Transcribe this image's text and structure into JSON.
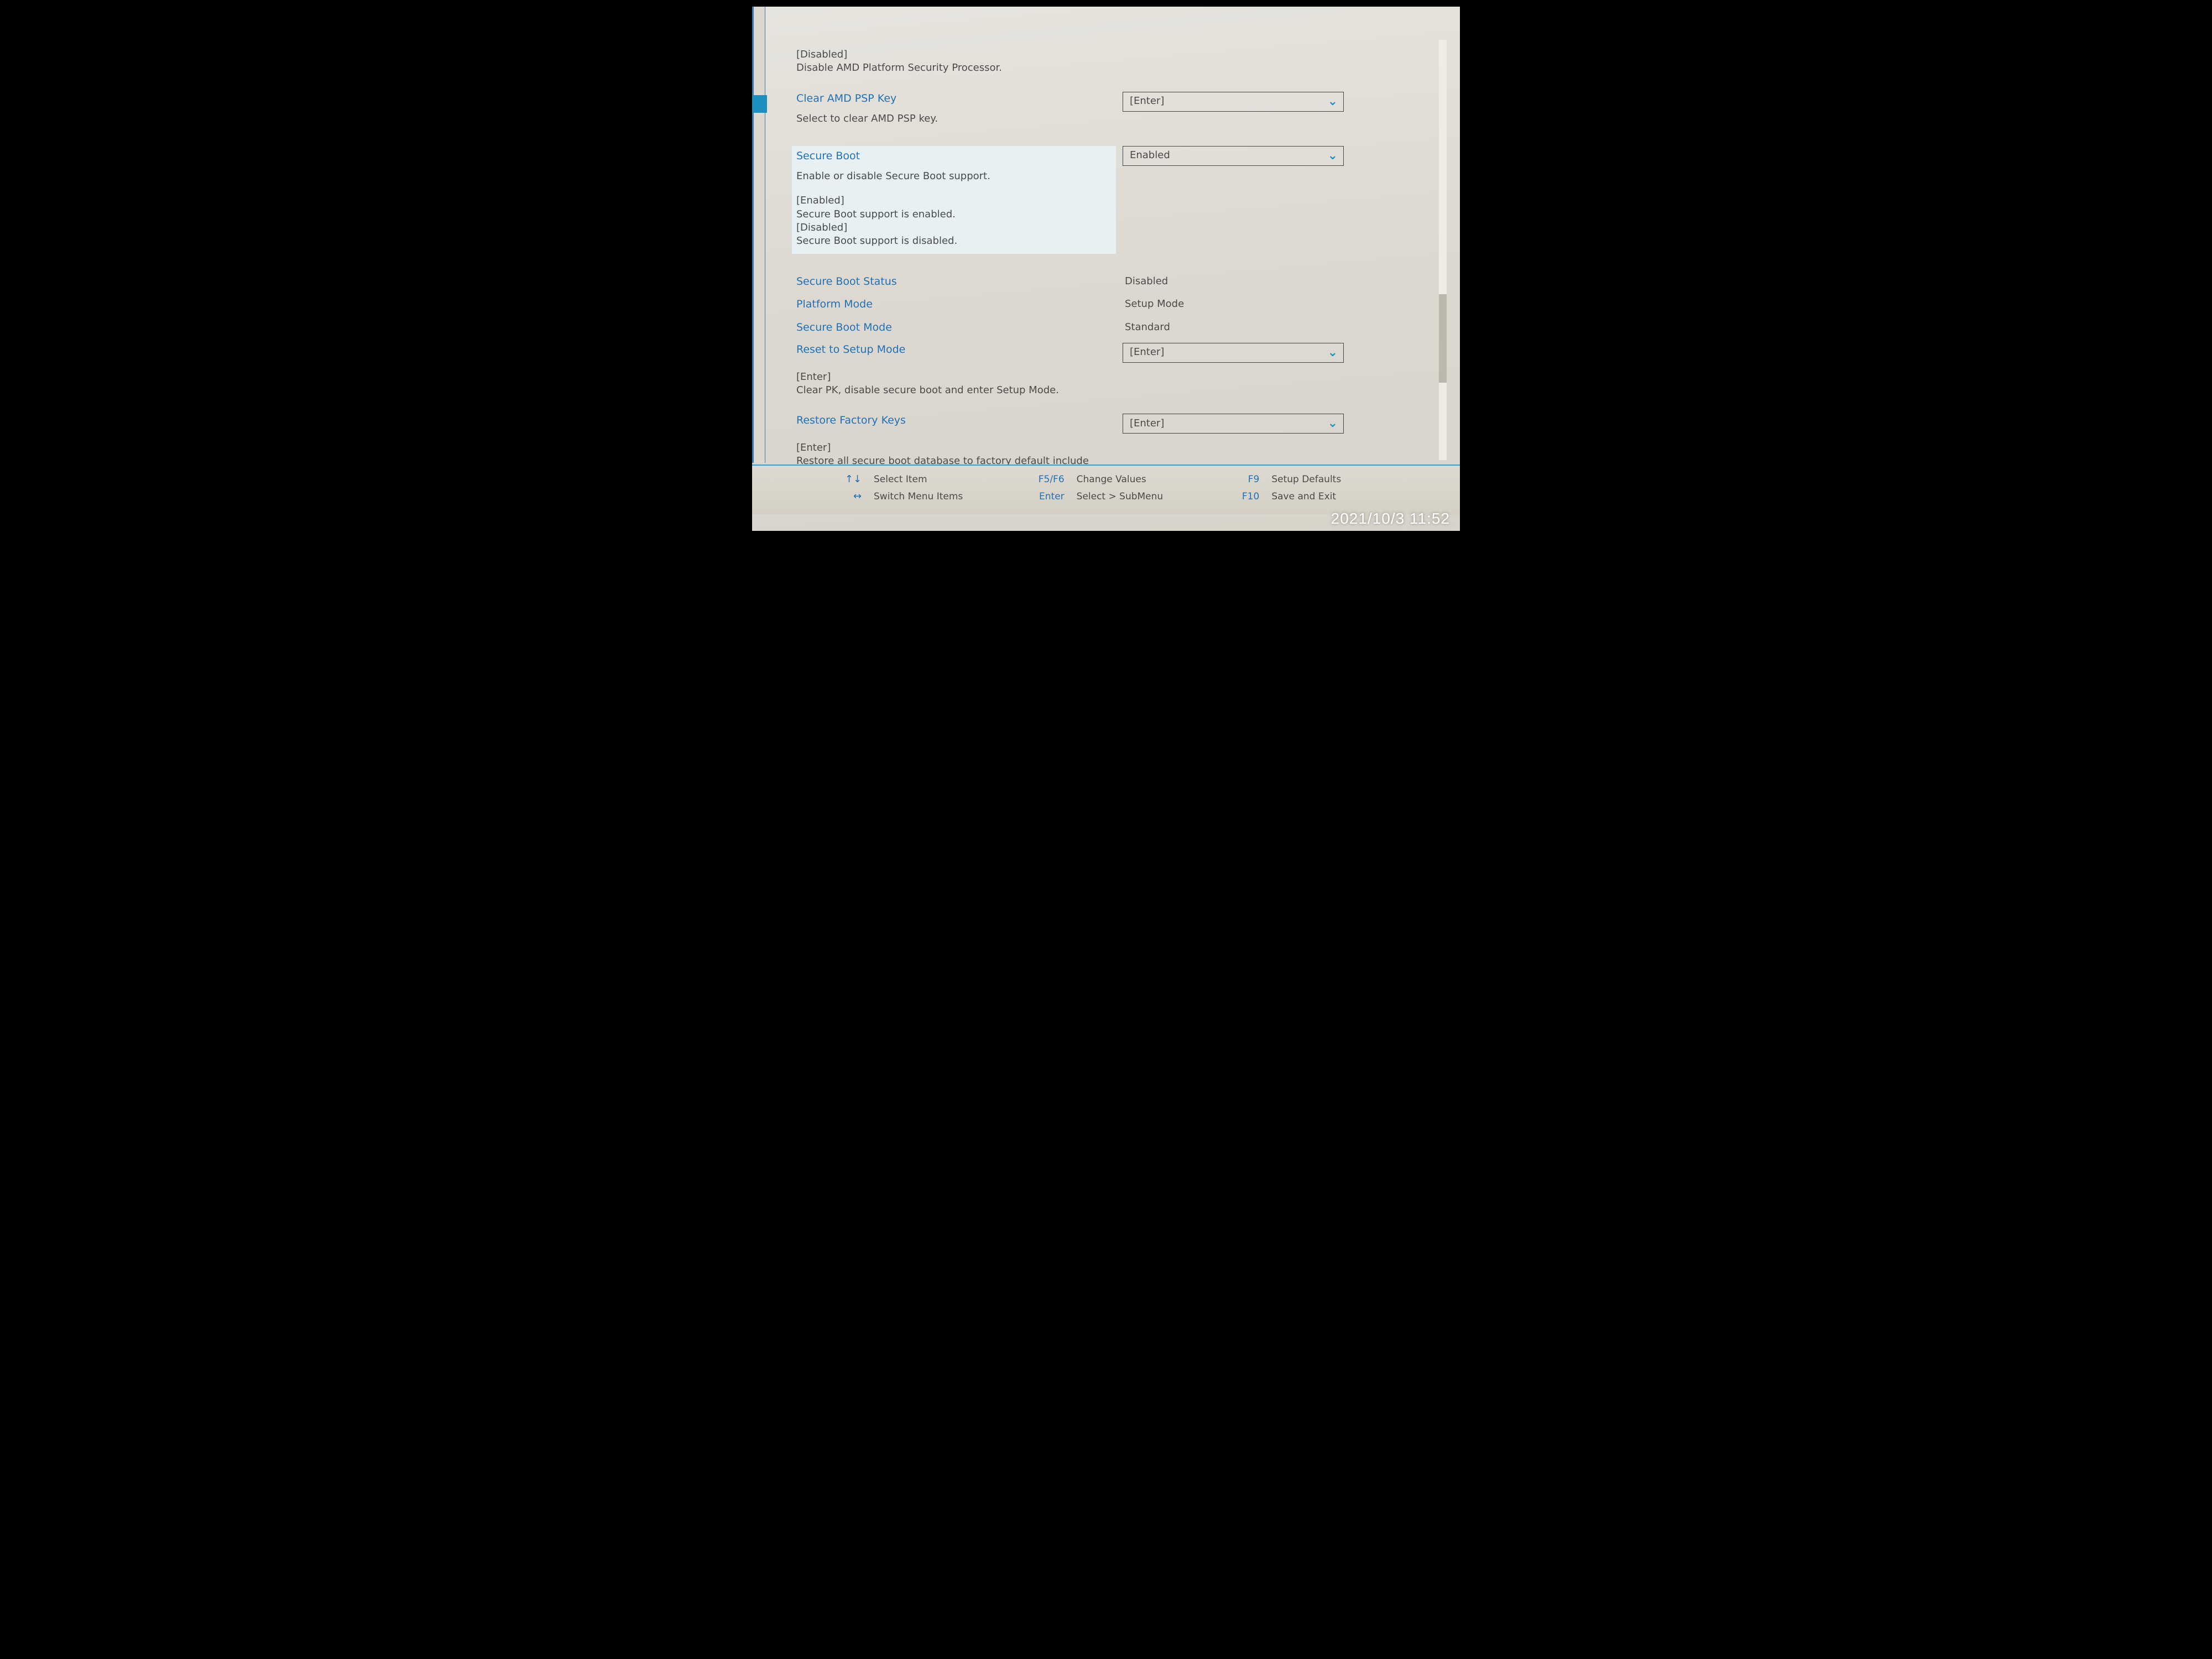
{
  "top_note": {
    "value_label": "[Disabled]",
    "desc": "Disable AMD Platform Security Processor."
  },
  "clear_psp": {
    "title": "Clear AMD PSP Key",
    "desc": "Select to clear AMD PSP key.",
    "value": "[Enter]"
  },
  "secure_boot": {
    "title": "Secure Boot",
    "desc": "Enable or disable Secure Boot support.",
    "opt_enabled_label": "[Enabled]",
    "opt_enabled_desc": "Secure Boot support is enabled.",
    "opt_disabled_label": "[Disabled]",
    "opt_disabled_desc": "Secure Boot support is disabled.",
    "value": "Enabled"
  },
  "status": {
    "label": "Secure Boot Status",
    "value": "Disabled"
  },
  "platform_mode": {
    "label": "Platform Mode",
    "value": "Setup Mode"
  },
  "sb_mode": {
    "label": "Secure Boot Mode",
    "value": "Standard"
  },
  "reset_setup": {
    "title": "Reset to Setup Mode",
    "value": "[Enter]",
    "note_label": "[Enter]",
    "note_desc": "Clear PK, disable secure boot and enter Setup Mode."
  },
  "restore_keys": {
    "title": "Restore Factory Keys",
    "value": "[Enter]",
    "note_label": "[Enter]",
    "note_desc": "Restore all secure boot database to factory default include PK, KEK, db and dbx."
  },
  "footer": {
    "select_item_key": "↑↓",
    "select_item": "Select Item",
    "switch_menu_key": "↔",
    "switch_menu": "Switch Menu Items",
    "change_values_key": "F5/F6",
    "change_values": "Change Values",
    "select_submenu_key": "Enter",
    "select_submenu": "Select > SubMenu",
    "defaults_key": "F9",
    "defaults": "Setup Defaults",
    "save_exit_key": "F10",
    "save_exit": "Save and Exit"
  },
  "camera_timestamp": "2021/10/3 11:52"
}
